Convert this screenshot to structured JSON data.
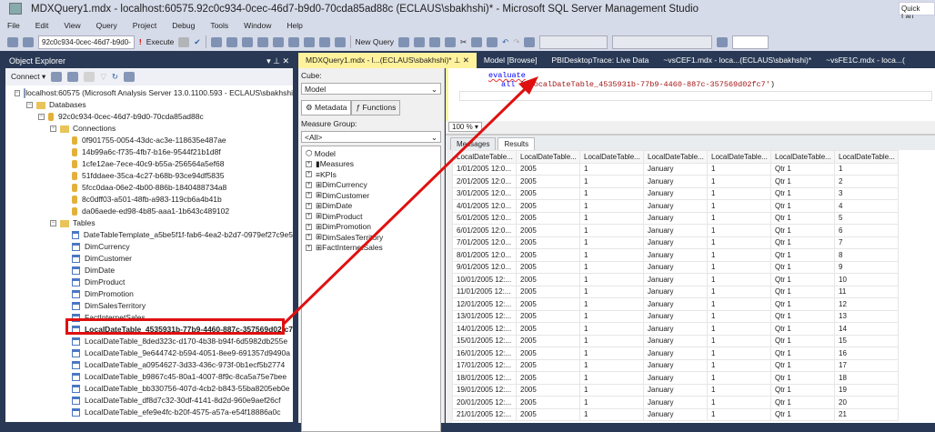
{
  "window": {
    "title": "MDXQuery1.mdx - localhost:60575.92c0c934-0cec-46d7-b9d0-70cda85ad88c (ECLAUS\\sbakhshi)* - Microsoft SQL Server Management Studio",
    "quick_launch": "Quick Lau"
  },
  "menu": [
    "File",
    "Edit",
    "View",
    "Query",
    "Project",
    "Debug",
    "Tools",
    "Window",
    "Help"
  ],
  "toolbar": {
    "database": "92c0c934-0cec-46d7-b9d0-",
    "execute": "Execute",
    "new_query": "New Query"
  },
  "object_explorer": {
    "title": "Object Explorer",
    "connect": "Connect",
    "server": "localhost:60575 (Microsoft Analysis Server 13.0.1100.593 - ECLAUS\\sbakhshi",
    "databases": "Databases",
    "database": "92c0c934-0cec-46d7-b9d0-70cda85ad88c",
    "connections_label": "Connections",
    "connections": [
      "0f901755-0054-43dc-ac3e-118635e487ae",
      "14b99a6c-f735-4fb7-b16e-9544f21b1d8f",
      "1cfe12ae-7ece-40c9-b55a-256564a5ef68",
      "51fddaee-35ca-4c27-b68b-93ce94df5835",
      "5fcc0daa-06e2-4b00-886b-1840488734a8",
      "8c0dff03-a501-48fb-a983-119cb6a4b41b",
      "da06aede-ed98-4b85-aaa1-1b643c489102"
    ],
    "tables_label": "Tables",
    "tables": [
      "DateTableTemplate_a5be5f1f-fab6-4ea2-b2d7-0979ef27c9e5",
      "DimCurrency",
      "DimCustomer",
      "DimDate",
      "DimProduct",
      "DimPromotion",
      "DimSalesTerritory",
      "FactInternetSales",
      "LocalDateTable_4535931b-77b9-4460-887c-357569d02fc7",
      "LocalDateTable_8ded323c-d170-4b38-b94f-6d5982db255e",
      "LocalDateTable_9e644742-b594-4051-8ee9-691357d9490a",
      "LocalDateTable_a0954627-3d33-436c-973f-0b1ecf5b2774",
      "LocalDateTable_b9867c45-80a1-4007-8f9c-8ca5a75e7bee",
      "LocalDateTable_bb330756-407d-4cb2-b843-55ba8205eb0e",
      "LocalDateTable_df8d7c32-30df-4141-8d2d-960e9aef26cf",
      "LocalDateTable_efe9e4fc-b20f-4575-a57a-e54f18886a0c"
    ],
    "highlighted_index": 8
  },
  "doc_tabs": [
    "MDXQuery1.mdx - l...(ECLAUS\\sbakhshi)*",
    "Model [Browse]",
    "PBIDesktopTrace: Live Data",
    "~vsCEF1.mdx - loca...(ECLAUS\\sbakhshi)*",
    "~vsFE1C.mdx - loca...("
  ],
  "cube_panel": {
    "cube_label": "Cube:",
    "cube": "Model",
    "tab_metadata": "Metadata",
    "tab_functions": "Functions",
    "measure_group_label": "Measure Group:",
    "measure_group": "<All>",
    "root": "Model",
    "items": [
      "Measures",
      "KPIs",
      "DimCurrency",
      "DimCustomer",
      "DimDate",
      "DimProduct",
      "DimPromotion",
      "DimSalesTerritory",
      "FactInternetSales"
    ]
  },
  "editor": {
    "line1": "evaluate",
    "kw2": "all",
    "line2_open": " (",
    "line2_str": "'LocalDateTable_4535931b-77b9-4460-887c-357569d02fc7'",
    "line2_close": ")"
  },
  "zoom": "100 %",
  "results": {
    "tab_messages": "Messages",
    "tab_results": "Results",
    "columns": [
      "LocalDateTable...",
      "LocalDateTable...",
      "LocalDateTable...",
      "LocalDateTable...",
      "LocalDateTable...",
      "LocalDateTable...",
      "LocalDateTable..."
    ],
    "rows": [
      [
        "1/01/2005 12:0...",
        "2005",
        "1",
        "January",
        "1",
        "Qtr 1",
        "1"
      ],
      [
        "2/01/2005 12:0...",
        "2005",
        "1",
        "January",
        "1",
        "Qtr 1",
        "2"
      ],
      [
        "3/01/2005 12:0...",
        "2005",
        "1",
        "January",
        "1",
        "Qtr 1",
        "3"
      ],
      [
        "4/01/2005 12:0...",
        "2005",
        "1",
        "January",
        "1",
        "Qtr 1",
        "4"
      ],
      [
        "5/01/2005 12:0...",
        "2005",
        "1",
        "January",
        "1",
        "Qtr 1",
        "5"
      ],
      [
        "6/01/2005 12:0...",
        "2005",
        "1",
        "January",
        "1",
        "Qtr 1",
        "6"
      ],
      [
        "7/01/2005 12:0...",
        "2005",
        "1",
        "January",
        "1",
        "Qtr 1",
        "7"
      ],
      [
        "8/01/2005 12:0...",
        "2005",
        "1",
        "January",
        "1",
        "Qtr 1",
        "8"
      ],
      [
        "9/01/2005 12:0...",
        "2005",
        "1",
        "January",
        "1",
        "Qtr 1",
        "9"
      ],
      [
        "10/01/2005 12:...",
        "2005",
        "1",
        "January",
        "1",
        "Qtr 1",
        "10"
      ],
      [
        "11/01/2005 12:...",
        "2005",
        "1",
        "January",
        "1",
        "Qtr 1",
        "11"
      ],
      [
        "12/01/2005 12:...",
        "2005",
        "1",
        "January",
        "1",
        "Qtr 1",
        "12"
      ],
      [
        "13/01/2005 12:...",
        "2005",
        "1",
        "January",
        "1",
        "Qtr 1",
        "13"
      ],
      [
        "14/01/2005 12:...",
        "2005",
        "1",
        "January",
        "1",
        "Qtr 1",
        "14"
      ],
      [
        "15/01/2005 12:...",
        "2005",
        "1",
        "January",
        "1",
        "Qtr 1",
        "15"
      ],
      [
        "16/01/2005 12:...",
        "2005",
        "1",
        "January",
        "1",
        "Qtr 1",
        "16"
      ],
      [
        "17/01/2005 12:...",
        "2005",
        "1",
        "January",
        "1",
        "Qtr 1",
        "17"
      ],
      [
        "18/01/2005 12:...",
        "2005",
        "1",
        "January",
        "1",
        "Qtr 1",
        "18"
      ],
      [
        "19/01/2005 12:...",
        "2005",
        "1",
        "January",
        "1",
        "Qtr 1",
        "19"
      ],
      [
        "20/01/2005 12:...",
        "2005",
        "1",
        "January",
        "1",
        "Qtr 1",
        "20"
      ],
      [
        "21/01/2005 12:...",
        "2005",
        "1",
        "January",
        "1",
        "Qtr 1",
        "21"
      ]
    ]
  },
  "colors": {
    "annotation": "#e01010",
    "chrome": "#293955",
    "active_tab": "#fff29d"
  }
}
